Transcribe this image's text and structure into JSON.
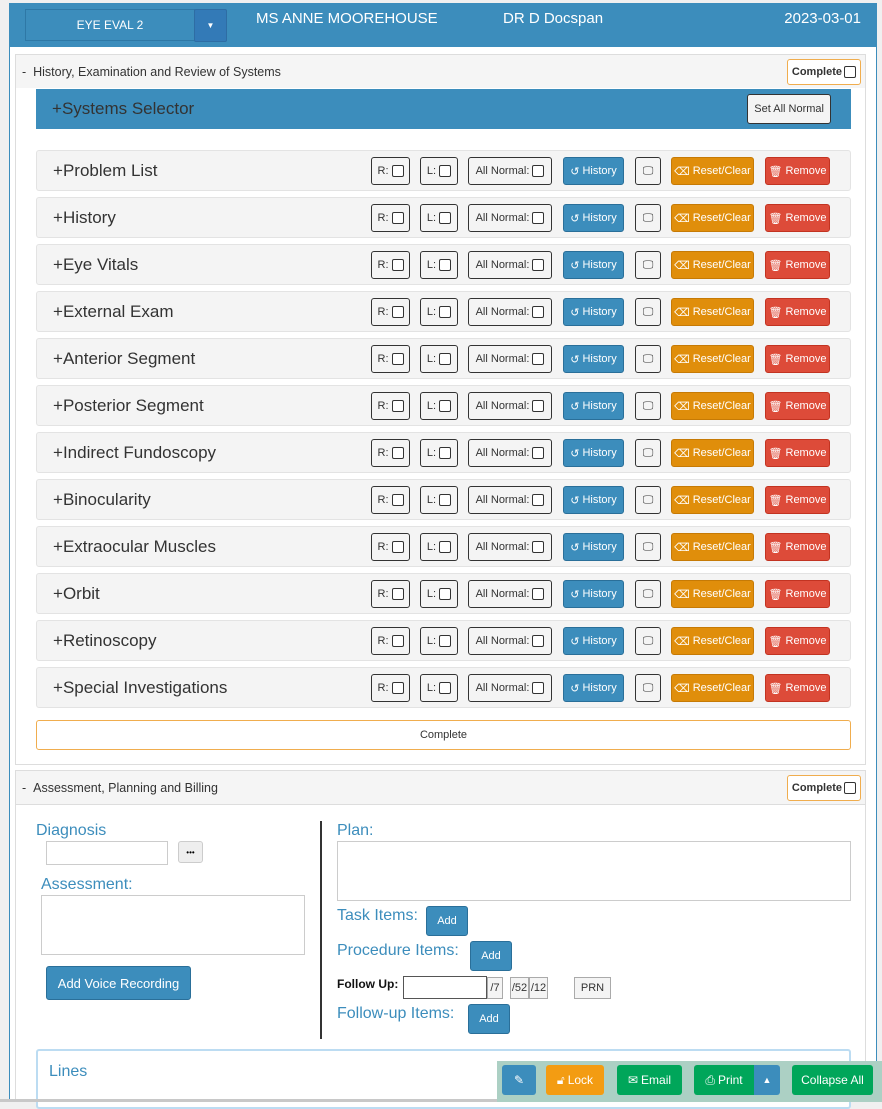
{
  "header": {
    "form_name": "EYE EVAL 2",
    "patient": "MS ANNE MOOREHOUSE",
    "doctor": "DR D Docspan",
    "date": "2023-03-01"
  },
  "section1": {
    "title": "History, Examination and Review of Systems",
    "collapse_symbol": "-",
    "complete_label": "Complete",
    "selector_title": "Systems Selector",
    "set_all_normal": "Set All Normal",
    "row_labels": {
      "right": "R:",
      "left": "L:",
      "all_normal": "All Normal:",
      "history": "History",
      "reset": "Reset/Clear",
      "remove": "Remove"
    },
    "systems": [
      "Problem List",
      "History",
      "Eye Vitals",
      "External Exam",
      "Anterior Segment",
      "Posterior Segment",
      "Indirect Fundoscopy",
      "Binocularity",
      "Extraocular Muscles",
      "Orbit",
      "Retinoscopy",
      "Special Investigations"
    ],
    "complete_bar": "Complete"
  },
  "section2": {
    "title": "Assessment, Planning and Billing",
    "collapse_symbol": "-",
    "complete_label": "Complete",
    "diagnosis_label": "Diagnosis",
    "diagnosis_value": "",
    "more_button": "•••",
    "assessment_label": "Assessment:",
    "assessment_value": "",
    "voice_button": "Add Voice Recording",
    "plan_label": "Plan:",
    "plan_value": "",
    "task_items": "Task Items:",
    "procedure_items": "Procedure Items:",
    "followup_items": "Follow-up Items:",
    "add": "Add",
    "follow_up_label": "Follow Up:",
    "follow_up_value": "",
    "follow_up_units": [
      "/7",
      "/52",
      "/12",
      "PRN"
    ],
    "lines_title": "Lines"
  },
  "toolbar": {
    "lock": "Lock",
    "email": "Email",
    "print": "Print",
    "collapse_all": "Collapse All"
  },
  "colors": {
    "primary": "#3c8dbc",
    "warning": "#e08e0b",
    "danger": "#dd4b39",
    "success": "#00a65a"
  }
}
